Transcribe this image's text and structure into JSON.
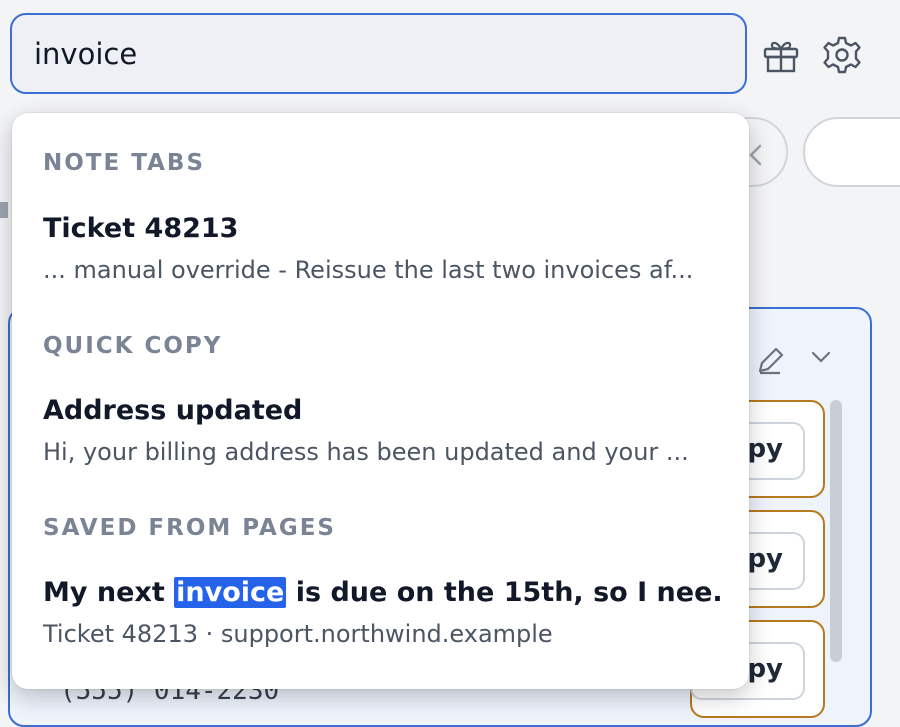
{
  "search": {
    "value": "invoice"
  },
  "icons": {
    "gift": "gift-icon",
    "settings": "gear-icon"
  },
  "dropdown": {
    "sections": [
      {
        "header": "NOTE TABS",
        "result": {
          "title": "Ticket 48213",
          "subtitle": "... manual override - Reissue the last two invoices af..."
        }
      },
      {
        "header": "QUICK COPY",
        "result": {
          "title": "Address updated",
          "subtitle": "Hi, your billing address has been updated and your ..."
        }
      },
      {
        "header": "SAVED FROM PAGES",
        "result": {
          "title_before": "My next ",
          "title_match": "invoice",
          "title_after": " is due on the 15th, so I nee...",
          "subtitle": "Ticket 48213 · support.northwind.example"
        }
      }
    ]
  },
  "background": {
    "copy_label_partial": "py",
    "phone_partial": "(555) 014-2230"
  },
  "colors": {
    "accent": "#3b6fd4",
    "highlight": "#2563eb",
    "section_header": "#7b8494",
    "card_border": "#b7791f"
  }
}
